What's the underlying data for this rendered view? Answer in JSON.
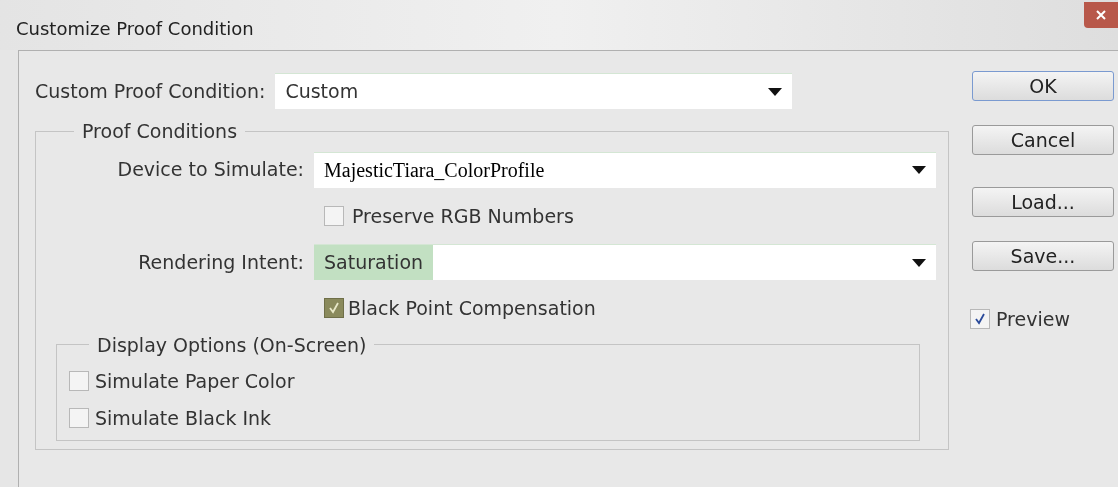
{
  "window": {
    "title": "Customize Proof Condition"
  },
  "custom_proof_condition": {
    "label": "Custom Proof Condition:",
    "value": "Custom"
  },
  "proof_conditions": {
    "title": "Proof Conditions",
    "device": {
      "label": "Device to Simulate:",
      "value": "MajesticTiara_ColorProfile"
    },
    "preserve_rgb": {
      "label": "Preserve RGB Numbers",
      "checked": false
    },
    "rendering_intent": {
      "label": "Rendering Intent:",
      "value": "Saturation",
      "selected": true
    },
    "black_point": {
      "label": "Black Point Compensation",
      "checked": true,
      "focused": true
    }
  },
  "display_options": {
    "title": "Display Options (On-Screen)",
    "items": [
      {
        "label": "Simulate Paper Color",
        "checked": false
      },
      {
        "label": "Simulate Black Ink",
        "checked": false
      }
    ]
  },
  "buttons": [
    {
      "label": "OK",
      "default": true
    },
    {
      "label": "Cancel",
      "default": false
    },
    {
      "label": "Load...",
      "default": false
    },
    {
      "label": "Save...",
      "default": false
    }
  ],
  "preview": {
    "label": "Preview",
    "checked": true
  }
}
